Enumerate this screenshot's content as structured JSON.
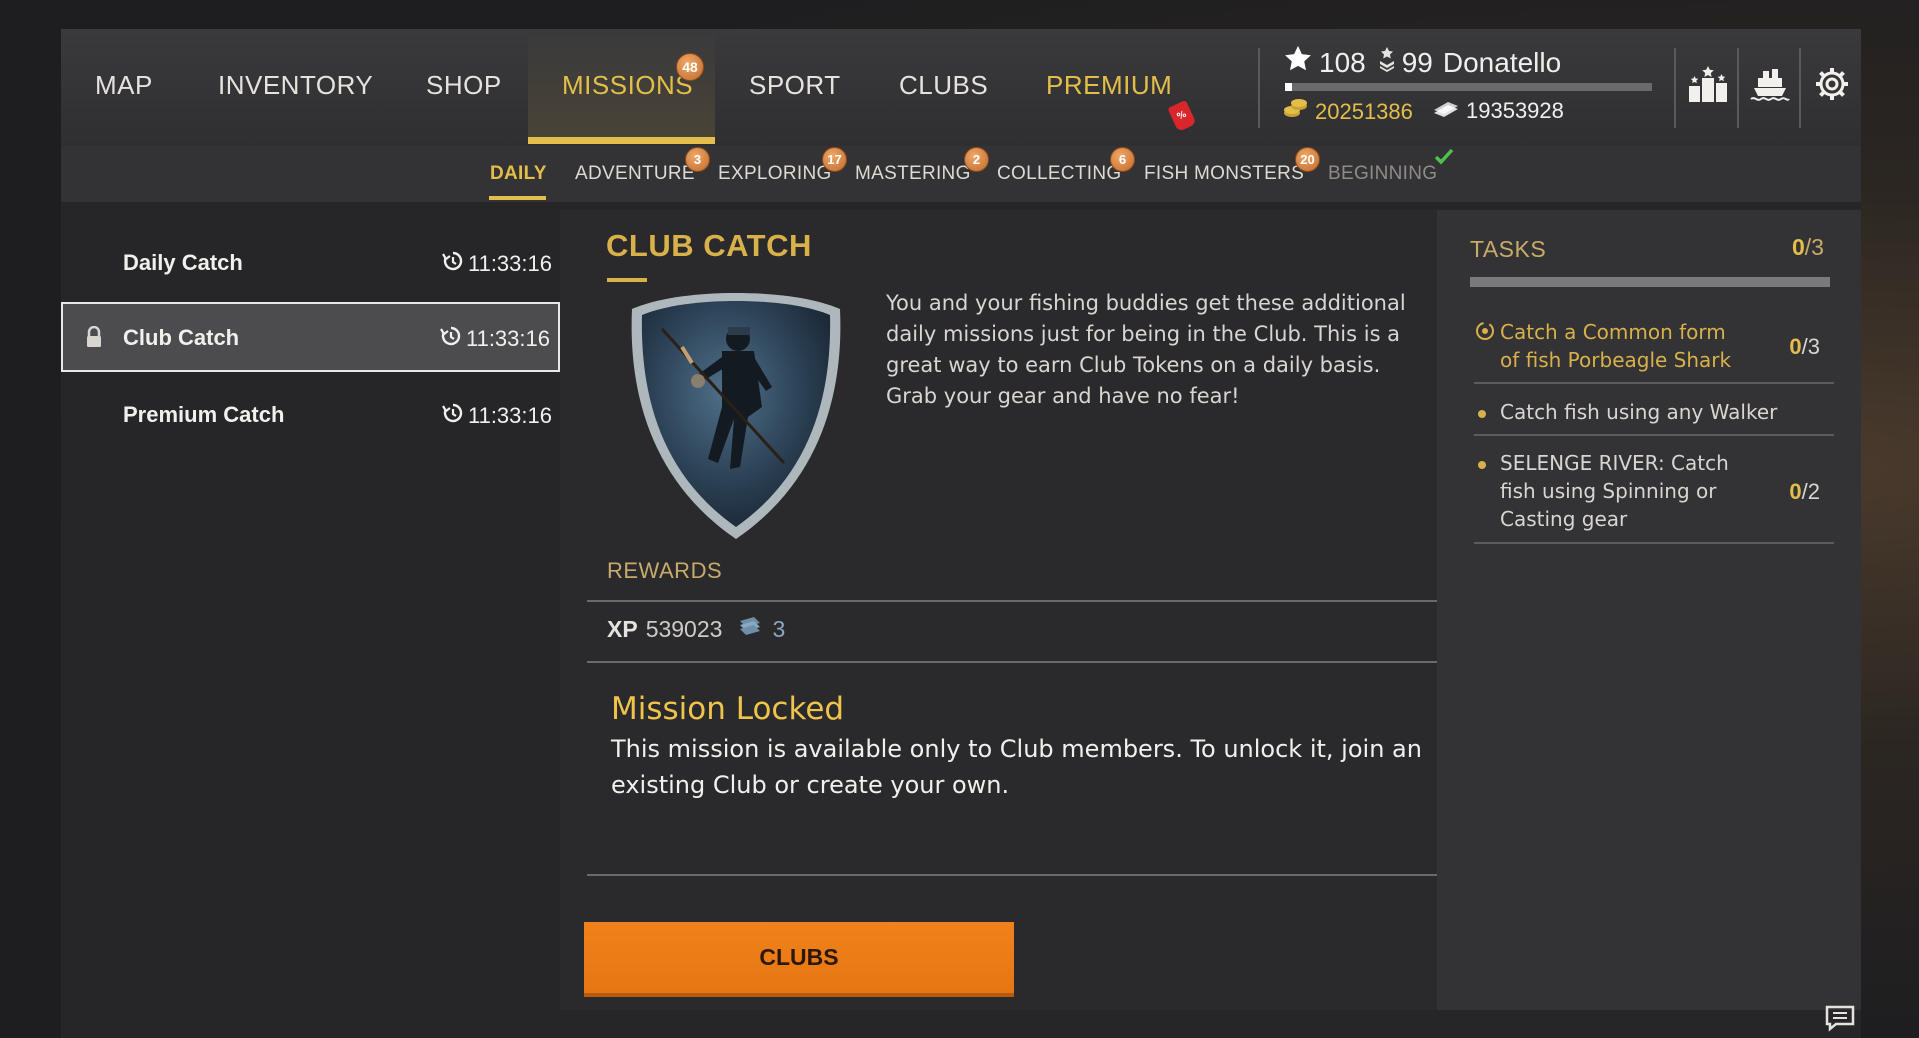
{
  "nav": {
    "items": [
      {
        "label": "MAP"
      },
      {
        "label": "INVENTORY"
      },
      {
        "label": "SHOP"
      },
      {
        "label": "MISSIONS",
        "badge": "48",
        "active": true
      },
      {
        "label": "SPORT"
      },
      {
        "label": "CLUBS"
      },
      {
        "label": "PREMIUM",
        "sale_tag": "%"
      }
    ]
  },
  "player": {
    "level": "108",
    "rank": "99",
    "name": "Donatello",
    "xp_progress": 0.02,
    "gold": "20251386",
    "silver": "19353928"
  },
  "right_icons": [
    "ranking-icon",
    "ships-icon",
    "settings-icon"
  ],
  "subnav": {
    "items": [
      {
        "label": "DAILY",
        "active": true
      },
      {
        "label": "ADVENTURE",
        "badge": "3"
      },
      {
        "label": "EXPLORING",
        "badge": "17"
      },
      {
        "label": "MASTERING",
        "badge": "2"
      },
      {
        "label": "COLLECTING",
        "badge": "6"
      },
      {
        "label": "FISH MONSTERS",
        "badge": "20"
      },
      {
        "label": "BEGINNING",
        "completed": true
      }
    ]
  },
  "missions": [
    {
      "name": "Daily Catch",
      "time": "11:33:16"
    },
    {
      "name": "Club Catch",
      "time": "11:33:16",
      "locked": true,
      "selected": true
    },
    {
      "name": "Premium Catch",
      "time": "11:33:16"
    }
  ],
  "detail": {
    "title": "CLUB CATCH",
    "description": "You and your fishing buddies get these additional daily missions just for being in the Club. This is a great way to earn Club Tokens on a daily basis. Grab your gear and have no fear!",
    "rewards_label": "REWARDS",
    "xp_label": "XP",
    "xp_value": "539023",
    "tokens_value": "3",
    "locked_title": "Mission Locked",
    "locked_text": "This mission is available only to Club members. To unlock it, join an existing Club or create your own.",
    "button_label": "CLUBS"
  },
  "tasks": {
    "title": "TASKS",
    "count_done": "0",
    "count_total": "/3",
    "items": [
      {
        "text": "Catch a Common form of fish Porbeagle Shark",
        "done": "0",
        "total": "/3",
        "active": true
      },
      {
        "text": "Catch fish using any Walker"
      },
      {
        "text": "SELENGE RIVER: Catch fish using Spinning or Casting gear",
        "done": "0",
        "total": "/2"
      }
    ]
  },
  "colors": {
    "accent_gold": "#e3bf4a",
    "button_orange": "#f0821c",
    "badge_orange": "#c06a2a"
  }
}
